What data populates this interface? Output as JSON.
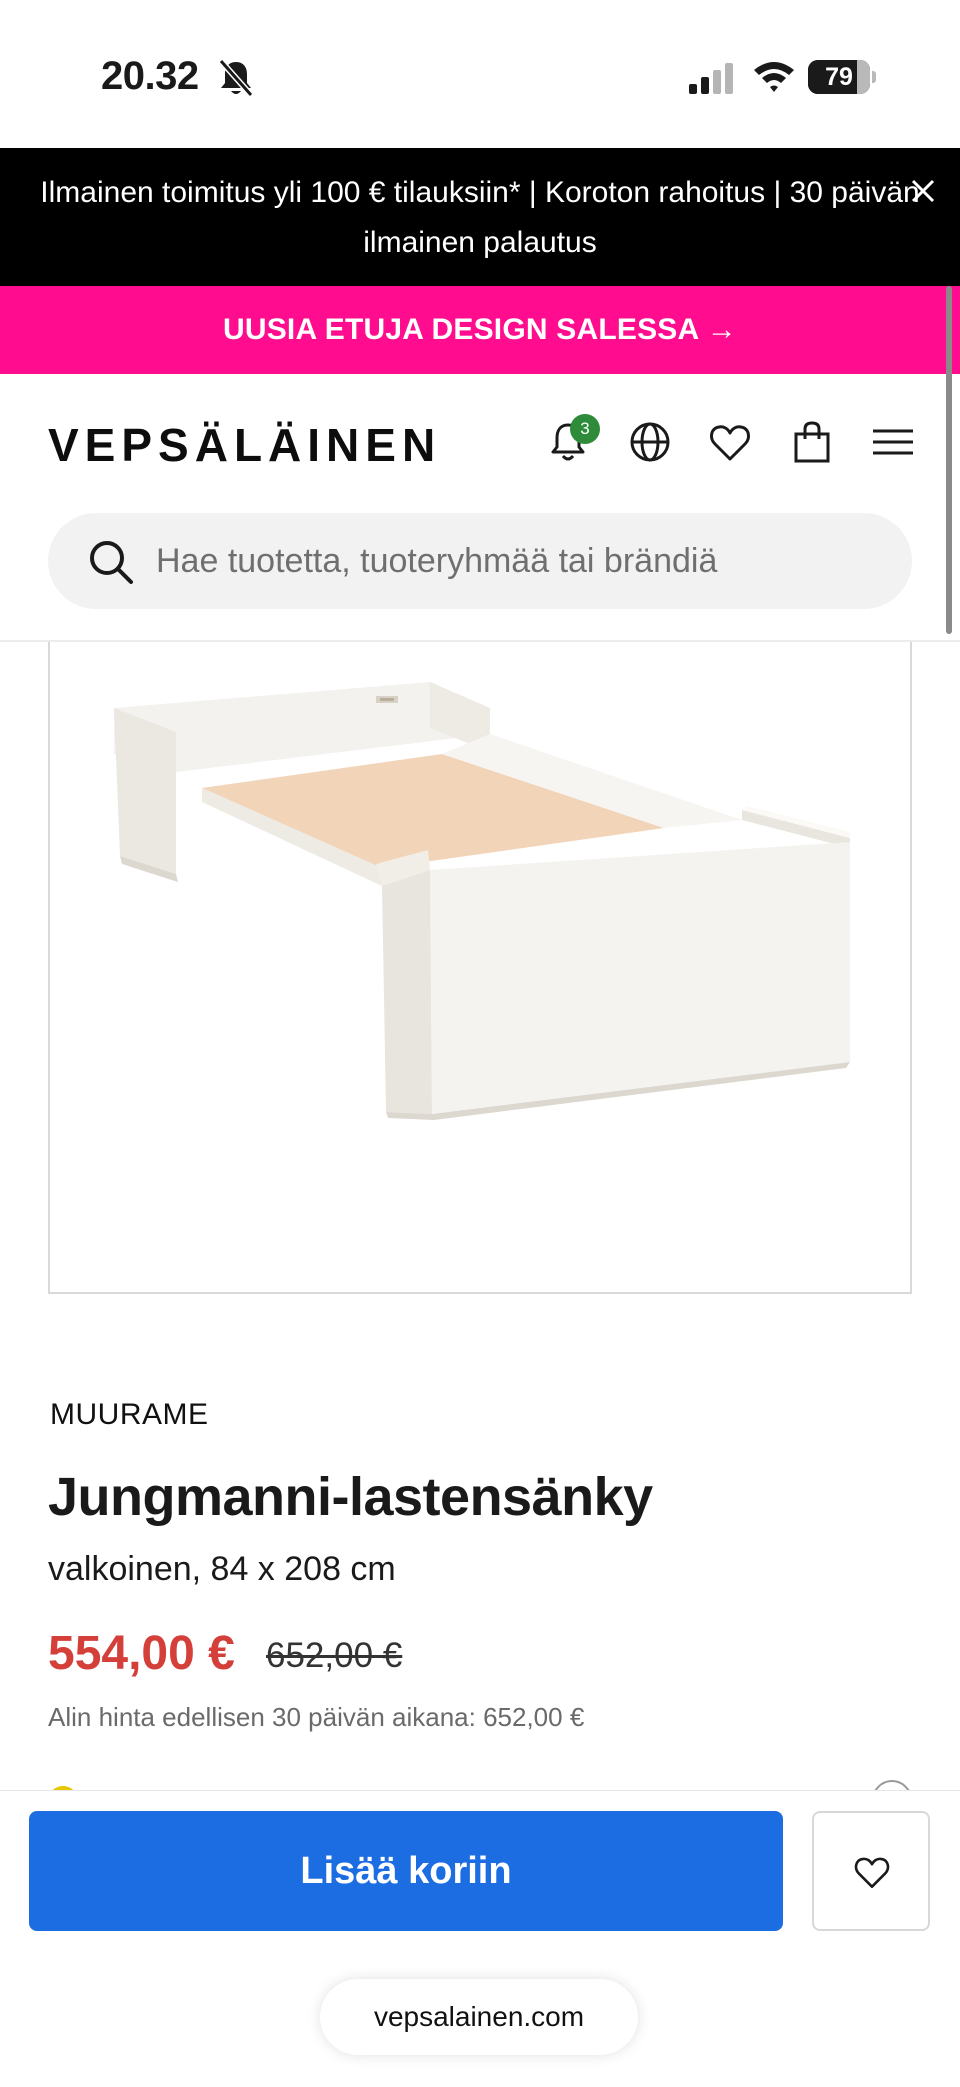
{
  "status_bar": {
    "time": "20.32",
    "battery_percent": "79",
    "battery_level": 0.79
  },
  "announcement": {
    "text": "Ilmainen toimitus yli 100 € tilauksiin* | Koroton rahoitus | 30 päivän ilmainen palautus"
  },
  "promo": {
    "text": "UUSIA ETUJA DESIGN SALESSA →"
  },
  "header": {
    "logo": "VEPSÄLÄINEN",
    "notifications_count": "3",
    "icons": [
      "bell-icon",
      "globe-icon",
      "heart-icon",
      "bag-icon",
      "menu-icon"
    ]
  },
  "search": {
    "placeholder": "Hae tuotetta, tuoteryhmää tai brändiä",
    "value": ""
  },
  "product": {
    "brand": "MUURAME",
    "title": "Jungmanni-lastensänky",
    "variant": "valkoinen, 84 x 208 cm",
    "price": "554,00 €",
    "old_price": "652,00 €",
    "lowest_price_note": "Alin hinta edellisen 30 päivän aikana: 652,00 €"
  },
  "sticky": {
    "add_to_cart": "Lisää koriin",
    "url": "vepsalainen.com"
  },
  "colors": {
    "promo_pink": "#ff0d8e",
    "sale_red": "#d43f3a",
    "cart_blue": "#1c6de2",
    "badge_green": "#2e8b3a"
  }
}
